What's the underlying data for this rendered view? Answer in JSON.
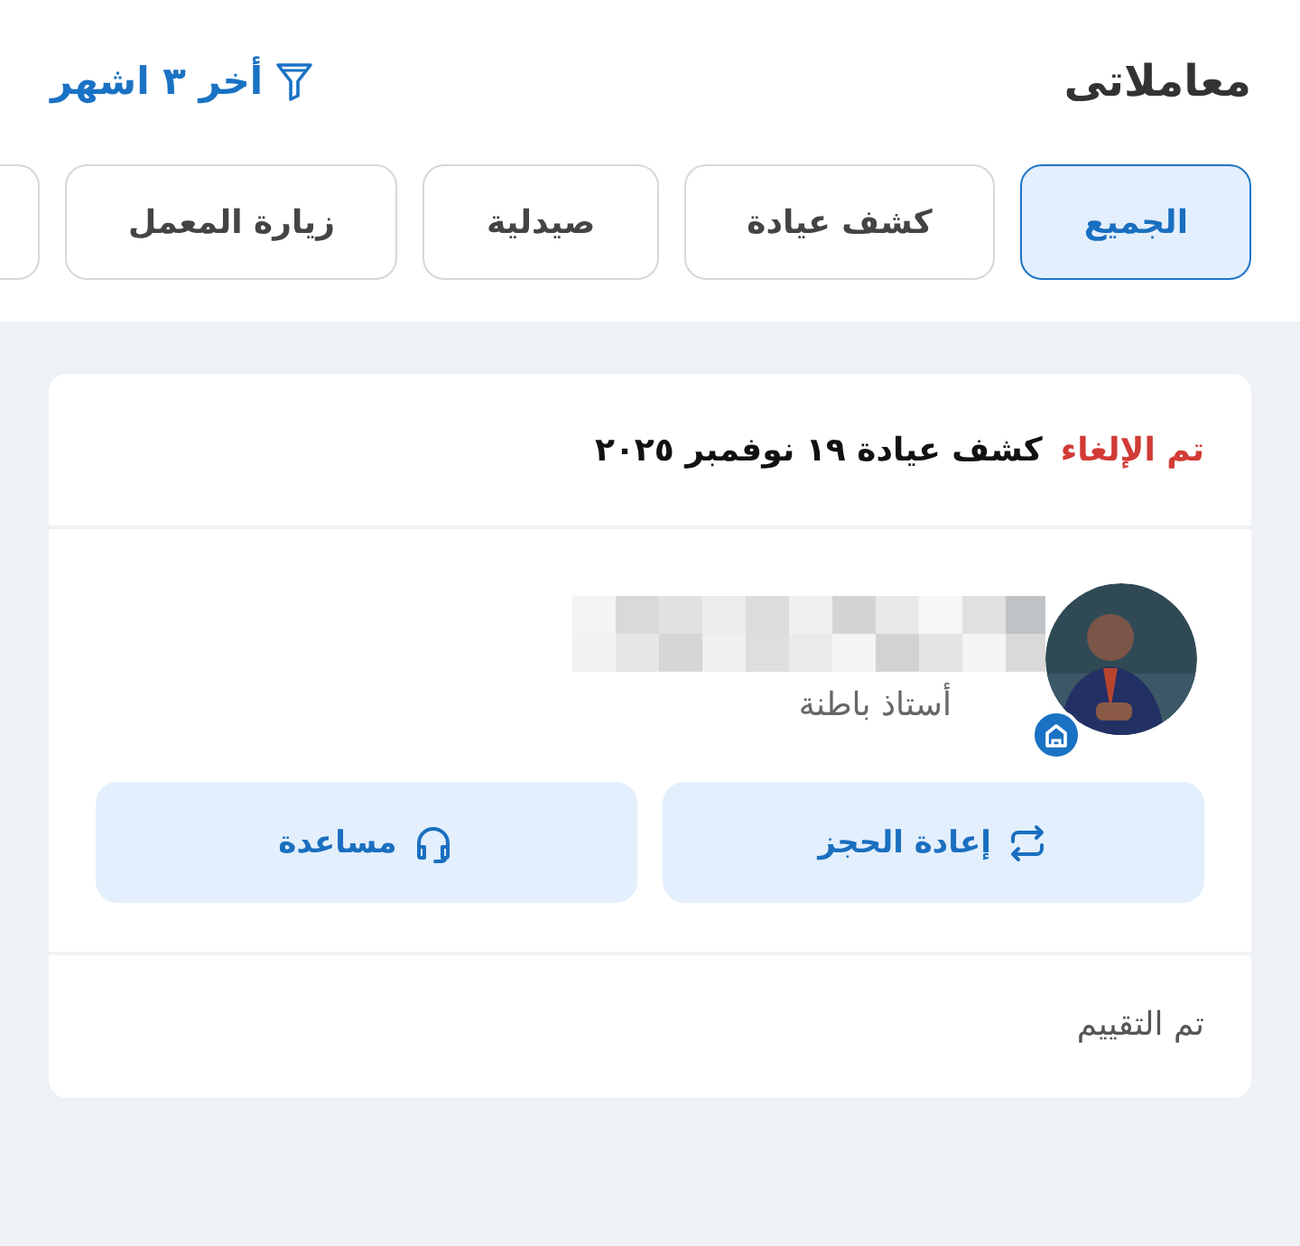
{
  "header": {
    "title": "معاملاتى",
    "filter": {
      "label": "أخر ٣ اشهر"
    }
  },
  "tabs": [
    {
      "label": "الجميع",
      "selected": true
    },
    {
      "label": "كشف عيادة",
      "selected": false
    },
    {
      "label": "صيدلية",
      "selected": false
    },
    {
      "label": "زيارة المعمل",
      "selected": false
    },
    {
      "selected": false
    }
  ],
  "transactions": [
    {
      "status": "تم الإلغاء",
      "cancelled": true,
      "summary": "كشف عيادة ١٩ نوفمبر ٢٠٢٥",
      "provider": {
        "subtitle": "أستاذ باطنة",
        "verified": true
      },
      "actions": [
        {
          "label": "إعادة الحجز",
          "kind": "rebook"
        },
        {
          "label": "مساعدة",
          "kind": "help"
        }
      ],
      "rating_status": "تم التقييم"
    }
  ]
}
